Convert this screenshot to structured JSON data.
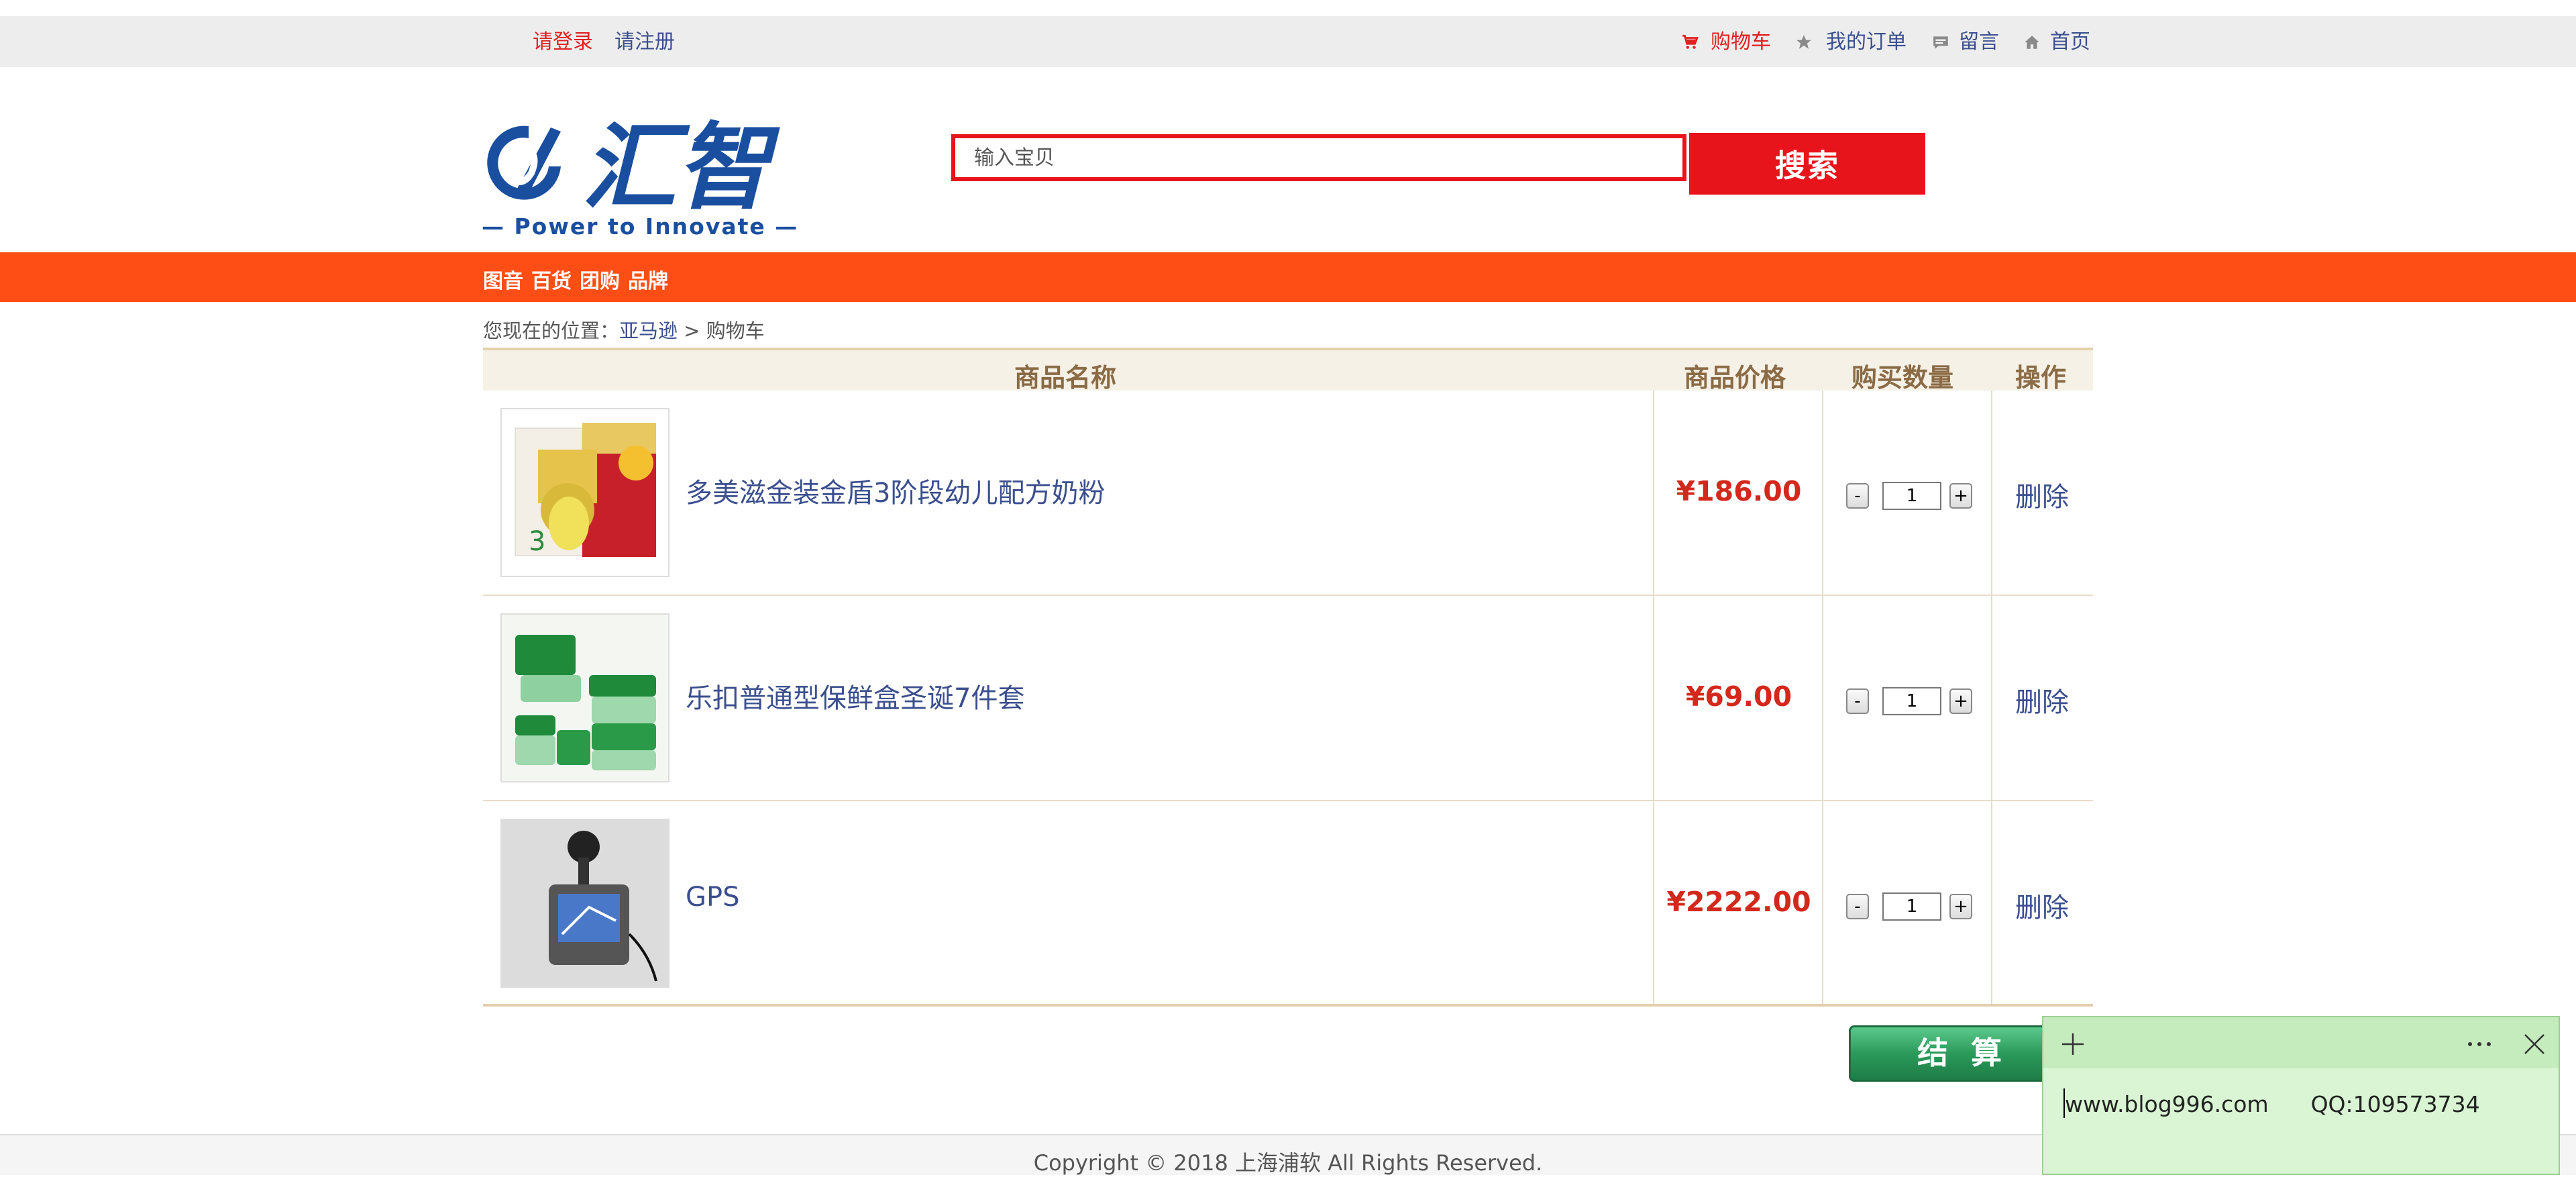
{
  "topbar": {
    "login": "请登录",
    "register": "请注册",
    "cart": "购物车",
    "orders": "我的订单",
    "messages": "留言",
    "home": "首页"
  },
  "logo": {
    "name": "汇智",
    "tagline": "— Power to Innovate —",
    "color": "#1a4fa0"
  },
  "search": {
    "placeholder": "输入宝贝",
    "button": "搜索"
  },
  "nav": {
    "items": [
      "图音",
      "百货",
      "团购",
      "品牌"
    ],
    "color": "#ff4e15"
  },
  "breadcrumb": {
    "prefix": "您现在的位置：",
    "link": "亚马逊",
    "separator": " > ",
    "current": "购物车"
  },
  "cart": {
    "headers": {
      "name": "商品名称",
      "price": "商品价格",
      "qty": "购买数量",
      "action": "操作"
    },
    "items": [
      {
        "name": "多美滋金装金盾3阶段幼儿配方奶粉",
        "price": "¥186.00",
        "qty": "1",
        "action": "删除"
      },
      {
        "name": "乐扣普通型保鲜盒圣诞7件套",
        "price": "¥69.00",
        "qty": "1",
        "action": "删除"
      },
      {
        "name": "GPS",
        "price": "¥2222.00",
        "qty": "1",
        "action": "删除"
      }
    ],
    "minus": "-",
    "plus": "+"
  },
  "checkout": {
    "label": "结算"
  },
  "footer": {
    "copyright": "Copyright © 2018 上海浦软 All Rights Reserved."
  },
  "note": {
    "text": "www.blog996.com      QQ:109573734"
  }
}
